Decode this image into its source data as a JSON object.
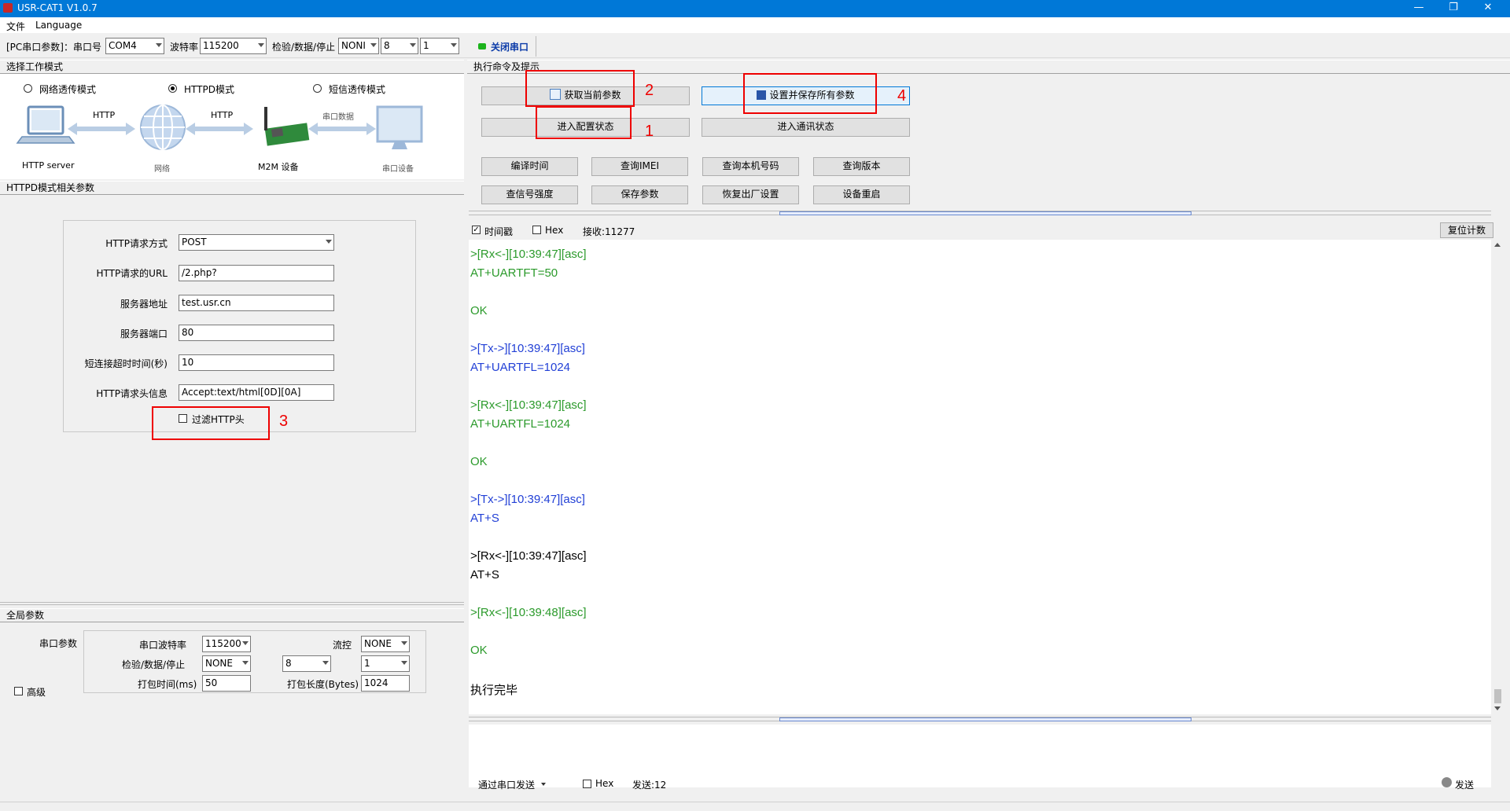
{
  "window": {
    "title": "USR-CAT1 V1.0.7"
  },
  "menu": {
    "file": "文件",
    "language": "Language"
  },
  "toolbar": {
    "pc_serial_label": "[PC串口参数]：串口号",
    "port": "COM4",
    "baud_label": "波特率",
    "baud": "115200",
    "check_label": "检验/数据/停止",
    "parity": "NONI",
    "databits": "8",
    "stopbits": "1",
    "close_port": "关闭串口",
    "status_color": "#1cb31c"
  },
  "work_mode": {
    "header": "选择工作模式",
    "modes": [
      "网络透传模式",
      "HTTPD模式",
      "短信透传模式"
    ],
    "selected": "HTTPD模式",
    "diagram": {
      "server": "HTTP server",
      "http1": "HTTP",
      "network": "网络",
      "http2": "HTTP",
      "m2m": "M2M 设备",
      "serial_data": "串口数据",
      "serial_device": "串口设备"
    }
  },
  "httpd": {
    "header": "HTTPD模式相关参数",
    "method_label": "HTTP请求方式",
    "method": "POST",
    "url_label": "HTTP请求的URL",
    "url": "/2.php?",
    "server_label": "服务器地址",
    "server": "test.usr.cn",
    "port_label": "服务器端口",
    "port": "80",
    "timeout_label": "短连接超时时间(秒)",
    "timeout": "10",
    "header_label": "HTTP请求头信息",
    "header_value": "Accept:text/html[0D][0A]",
    "filter_label": "过滤HTTP头",
    "filter_checked": false
  },
  "global": {
    "header": "全局参数",
    "serial_params": "串口参数",
    "baud_label": "串口波特率",
    "baud": "115200",
    "flow_label": "流控",
    "flow": "NONE",
    "check_label": "检验/数据/停止",
    "parity": "NONE",
    "databits": "8",
    "stopbits": "1",
    "pack_time_label": "打包时间(ms)",
    "pack_time": "50",
    "pack_len_label": "打包长度(Bytes)",
    "pack_len": "1024",
    "advanced": "高级"
  },
  "commands": {
    "header": "执行命令及提示",
    "get_params": "获取当前参数",
    "set_save": "设置并保存所有参数",
    "enter_config": "进入配置状态",
    "enter_comm": "进入通讯状态",
    "row1": [
      "编译时间",
      "查询IMEI",
      "查询本机号码",
      "查询版本"
    ],
    "row2": [
      "查信号强度",
      "保存参数",
      "恢复出厂设置",
      "设备重启"
    ]
  },
  "log_bar": {
    "timestamp": "时间戳",
    "timestamp_checked": true,
    "hex": "Hex",
    "received": "接收:11277",
    "reset": "复位计数"
  },
  "log": [
    {
      "text": ">[Rx<-][10:39:47][asc]",
      "color": "#2b9a2b"
    },
    {
      "text": "AT+UARTFT=50",
      "color": "#2b9a2b"
    },
    {
      "text": "",
      "color": "#2b9a2b"
    },
    {
      "text": "OK",
      "color": "#2b9a2b"
    },
    {
      "text": "",
      "color": "#2b9a2b"
    },
    {
      "text": ">[Tx->][10:39:47][asc]",
      "color": "#2240d6"
    },
    {
      "text": "AT+UARTFL=1024",
      "color": "#2240d6"
    },
    {
      "text": "",
      "color": "#2b9a2b"
    },
    {
      "text": ">[Rx<-][10:39:47][asc]",
      "color": "#2b9a2b"
    },
    {
      "text": "AT+UARTFL=1024",
      "color": "#2b9a2b"
    },
    {
      "text": "",
      "color": "#2b9a2b"
    },
    {
      "text": "OK",
      "color": "#2b9a2b"
    },
    {
      "text": "",
      "color": "#2b9a2b"
    },
    {
      "text": ">[Tx->][10:39:47][asc]",
      "color": "#2240d6"
    },
    {
      "text": "AT+S",
      "color": "#2240d6"
    },
    {
      "text": "",
      "color": "#000000"
    },
    {
      "text": ">[Rx<-][10:39:47][asc]",
      "color": "#000000"
    },
    {
      "text": "AT+S",
      "color": "#000000"
    },
    {
      "text": "",
      "color": "#2b9a2b"
    },
    {
      "text": ">[Rx<-][10:39:48][asc]",
      "color": "#2b9a2b"
    },
    {
      "text": "",
      "color": "#2b9a2b"
    },
    {
      "text": "OK",
      "color": "#2b9a2b"
    },
    {
      "text": "",
      "color": "#000000"
    },
    {
      "text": "执行完毕",
      "color": "#000000"
    }
  ],
  "send_bar": {
    "send_via": "通过串口发送",
    "hex": "Hex",
    "sent": "发送:12",
    "send": "发送"
  },
  "annotations": {
    "n1": "1",
    "n2": "2",
    "n3": "3",
    "n4": "4",
    "color": "#e00000"
  }
}
